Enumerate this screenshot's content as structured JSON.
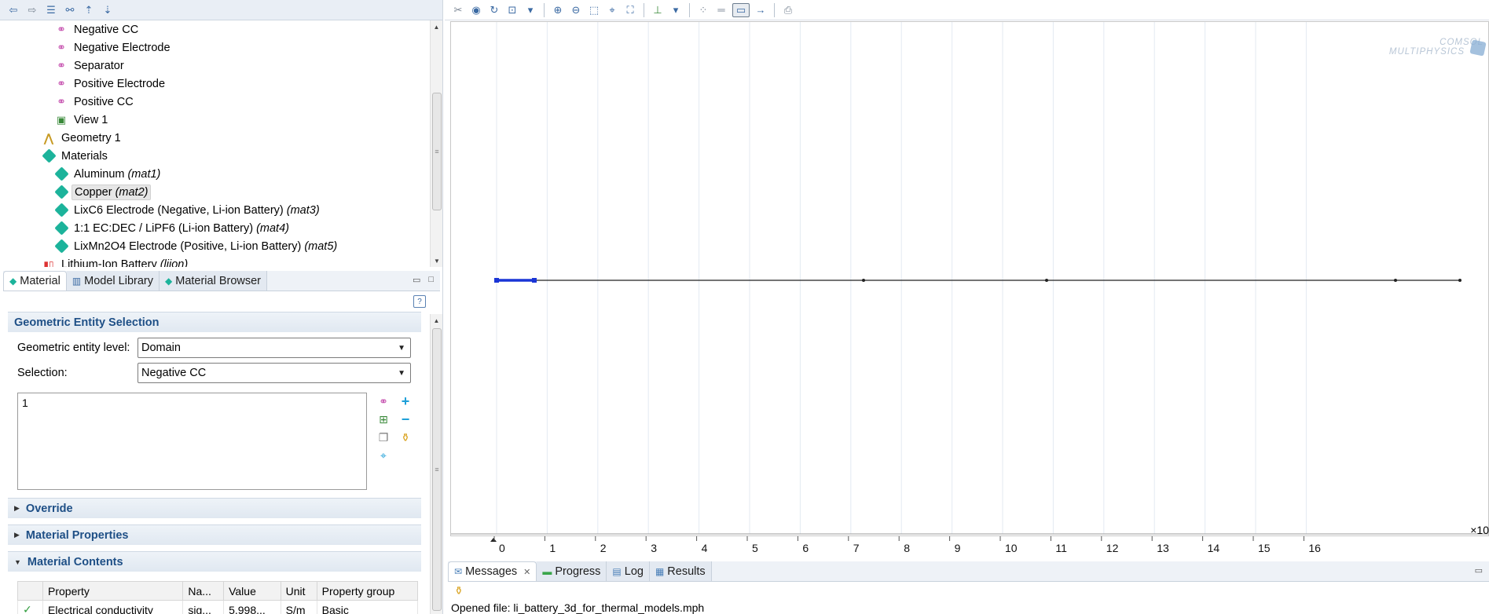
{
  "tree": {
    "items": [
      {
        "label": "Negative CC",
        "tag": "",
        "icon": "selection-icon",
        "indent": 2
      },
      {
        "label": "Negative Electrode",
        "tag": "",
        "icon": "selection-icon",
        "indent": 2
      },
      {
        "label": "Separator",
        "tag": "",
        "icon": "selection-icon",
        "indent": 2
      },
      {
        "label": "Positive Electrode",
        "tag": "",
        "icon": "selection-icon",
        "indent": 2
      },
      {
        "label": "Positive CC",
        "tag": "",
        "icon": "selection-icon",
        "indent": 2
      },
      {
        "label": "View 1",
        "tag": "",
        "icon": "view-icon",
        "indent": 2
      },
      {
        "label": "Geometry 1",
        "tag": "",
        "icon": "geometry-icon",
        "indent": 1
      },
      {
        "label": "Materials",
        "tag": "",
        "icon": "materials-icon",
        "indent": 1
      },
      {
        "label": "Aluminum",
        "tag": "(mat1)",
        "icon": "material-icon",
        "indent": 2
      },
      {
        "label": "Copper",
        "tag": "(mat2)",
        "icon": "material-icon",
        "indent": 2,
        "selected": true
      },
      {
        "label": "LixC6 Electrode (Negative, Li-ion Battery)",
        "tag": "(mat3)",
        "icon": "material-icon",
        "indent": 2
      },
      {
        "label": "1:1 EC:DEC / LiPF6 (Li-ion Battery)",
        "tag": "(mat4)",
        "icon": "material-icon",
        "indent": 2
      },
      {
        "label": "LixMn2O4 Electrode (Positive, Li-ion Battery)",
        "tag": "(mat5)",
        "icon": "material-icon",
        "indent": 2
      },
      {
        "label": "Lithium-Ion Battery",
        "tag": "(liion)",
        "icon": "physics-icon",
        "indent": 1
      }
    ]
  },
  "tabs": {
    "material": "Material",
    "model_library": "Model Library",
    "material_browser": "Material Browser"
  },
  "settings": {
    "section_geometric": "Geometric Entity Selection",
    "entity_level_label": "Geometric entity level:",
    "entity_level_value": "Domain",
    "selection_label": "Selection:",
    "selection_value": "Negative CC",
    "selection_list": "1",
    "section_override": "Override",
    "section_properties": "Material Properties",
    "section_contents": "Material Contents",
    "table": {
      "headers": [
        "Property",
        "Na...",
        "Value",
        "Unit",
        "Property group"
      ],
      "rows": [
        [
          "Electrical conductivity",
          "sig...",
          "5.998...",
          "S/m",
          "Basic"
        ]
      ]
    }
  },
  "graphics": {
    "x_ticks": [
      "0",
      "1",
      "2",
      "3",
      "4",
      "5",
      "6",
      "7",
      "8",
      "9",
      "10",
      "11",
      "12",
      "13",
      "14",
      "15",
      "16"
    ],
    "axis_multiplier": "×10",
    "logo_line1": "COMSOL",
    "logo_line2": "MULTIPHYSICS"
  },
  "messages": {
    "tabs": {
      "messages": "Messages",
      "progress": "Progress",
      "log": "Log",
      "results": "Results"
    },
    "text": "Opened file: li_battery_3d_for_thermal_models.mph"
  }
}
